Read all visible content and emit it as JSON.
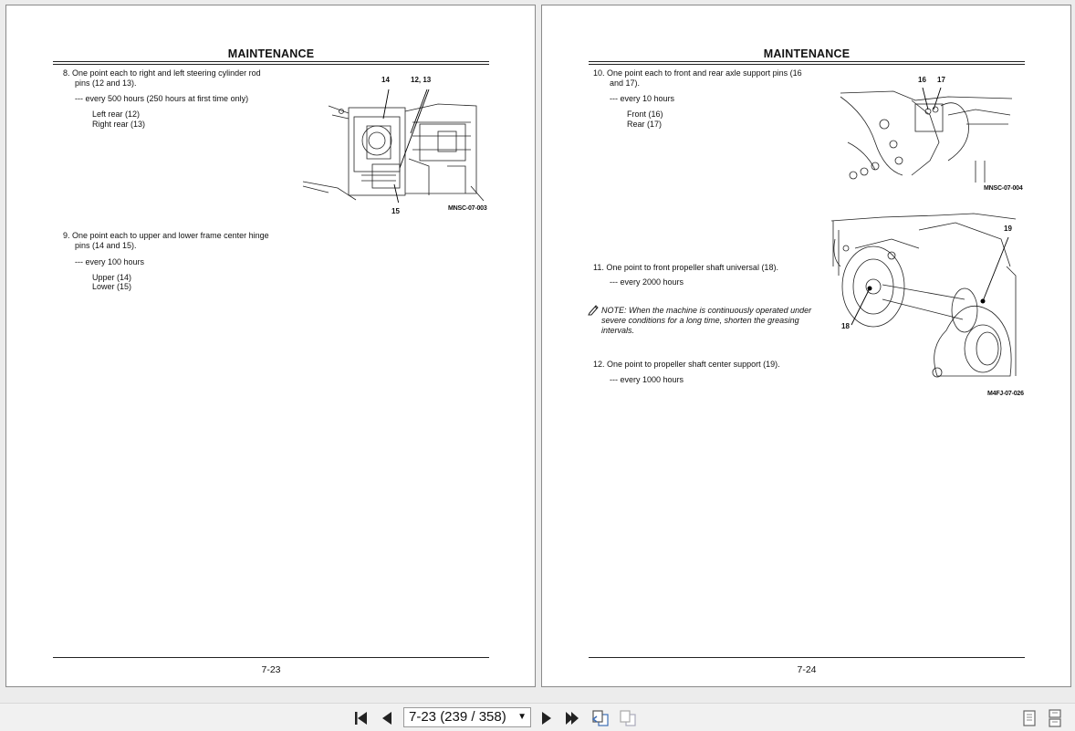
{
  "left_page": {
    "header": "MAINTENANCE",
    "page_number": "7-23",
    "item8": {
      "line1": "8.  One point each to right and left steering cylinder rod",
      "line2": "pins (12 and 13).",
      "interval": "--- every 500 hours (250 hours at first time only)",
      "loc1": "Left rear (12)",
      "loc2": "Right rear (13)"
    },
    "item9": {
      "line1": "9.  One point each to upper and lower frame center hinge",
      "line2": "pins (14 and 15).",
      "interval": "--- every 100 hours",
      "loc1": "Upper (14)",
      "loc2": "Lower (15)"
    },
    "figure": {
      "label_a": "14",
      "label_b": "12, 13",
      "label_c": "15",
      "id": "MNSC-07-003"
    }
  },
  "right_page": {
    "header": "MAINTENANCE",
    "page_number": "7-24",
    "item10": {
      "line1": "10.  One point each to front and rear axle support pins (16",
      "line2": "and 17).",
      "interval": "--- every 10 hours",
      "loc1": "Front (16)",
      "loc2": "Rear (17)"
    },
    "item11": {
      "line1": "11.  One point to front propeller shaft universal (18).",
      "interval": "--- every 2000 hours"
    },
    "note": {
      "line1": "NOTE:   When the machine is continuously operated under",
      "line2": "severe conditions for a long time, shorten the greasing",
      "line3": "intervals."
    },
    "item12": {
      "line1": "12.  One point to propeller shaft center support (19).",
      "interval": "--- every 1000 hours"
    },
    "figure1": {
      "label_a": "16",
      "label_b": "17",
      "id": "MNSC-07-004"
    },
    "figure2": {
      "label_a": "19",
      "label_b": "18",
      "id": "M4FJ-07-026"
    }
  },
  "toolbar": {
    "page_indicator": "7-23 (239 / 358)",
    "icons": [
      "first-page-icon",
      "prev-page-icon",
      "next-page-icon",
      "last-page-icon",
      "go-back-view-icon",
      "go-forward-view-icon",
      "single-page-view-icon",
      "continuous-view-icon"
    ]
  }
}
